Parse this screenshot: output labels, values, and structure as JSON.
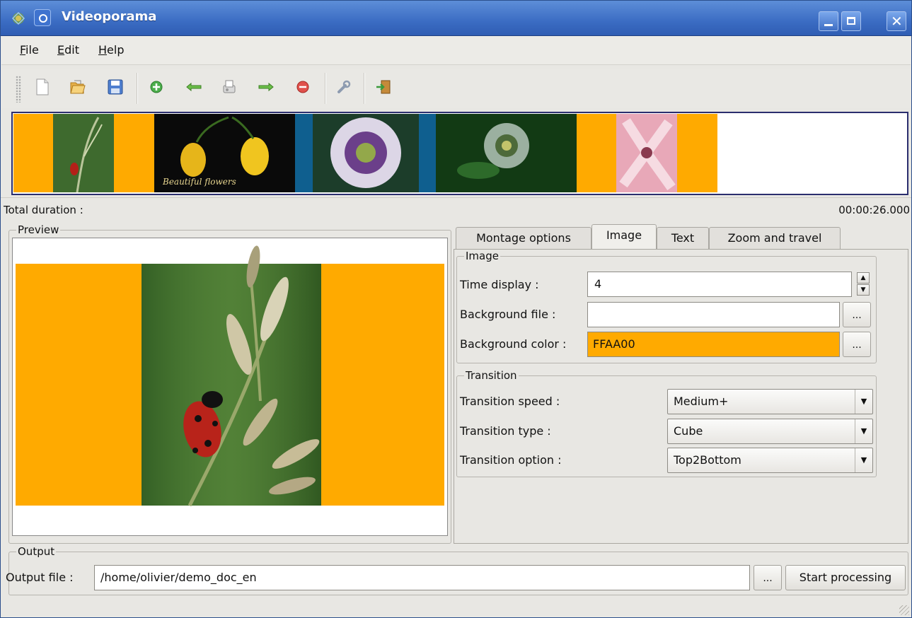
{
  "window": {
    "title": "Videoporama"
  },
  "menu": [
    {
      "label": "File",
      "mnemonic": "F",
      "rest": "ile"
    },
    {
      "label": "Edit",
      "mnemonic": "E",
      "rest": "dit"
    },
    {
      "label": "Help",
      "mnemonic": "H",
      "rest": "elp"
    }
  ],
  "toolbar": {
    "icons": [
      "new-document-icon",
      "open-folder-icon",
      "save-icon",
      "add-icon",
      "move-left-arrow-icon",
      "printer-icon",
      "move-right-arrow-icon",
      "remove-icon",
      "wrench-settings-icon",
      "exit-icon"
    ]
  },
  "filmstrip": {
    "accent": "#FFAA00",
    "items": [
      {
        "name": "ladybug",
        "background": "#FFAA00"
      },
      {
        "name": "yellow-flowers",
        "background": "#0a0a0a",
        "caption": "Beautiful flowers"
      },
      {
        "name": "passion-flower",
        "background": "#0f5f8f"
      },
      {
        "name": "passion-flower-green",
        "background": "#123a14"
      },
      {
        "name": "lily",
        "background": "#FFAA00"
      }
    ]
  },
  "status": {
    "total_duration_label": "Total duration :",
    "total_duration_value": "00:00:26.000"
  },
  "preview": {
    "group_label": "Preview"
  },
  "tabs": [
    {
      "label": "Montage options",
      "active": false
    },
    {
      "label": "Image",
      "active": true
    },
    {
      "label": "Text",
      "active": false
    },
    {
      "label": "Zoom and travel",
      "active": false
    }
  ],
  "image_group": {
    "label": "Image",
    "time_display_label": "Time display :",
    "time_display_value": "4",
    "background_file_label": "Background file :",
    "background_file_value": "",
    "background_color_label": "Background color :",
    "background_color_value": "FFAA00",
    "browse_label": "..."
  },
  "transition_group": {
    "label": "Transition",
    "speed_label": "Transition speed :",
    "speed_value": "Medium+",
    "type_label": "Transition type :",
    "type_value": "Cube",
    "option_label": "Transition option :",
    "option_value": "Top2Bottom"
  },
  "output": {
    "group_label": "Output",
    "file_label": "Output file :",
    "file_value": "/home/olivier/demo_doc_en",
    "browse_label": "...",
    "start_label": "Start processing"
  }
}
